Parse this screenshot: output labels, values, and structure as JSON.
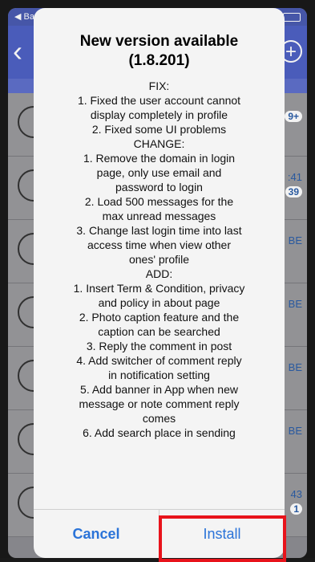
{
  "background_app": {
    "status_back": "◀ Ba",
    "rows": [
      {
        "meta_top": "",
        "badge": "9+"
      },
      {
        "meta_top": ":41",
        "badge": "39"
      },
      {
        "meta_top": "BE",
        "badge": ""
      },
      {
        "meta_top": "BE",
        "badge": ""
      },
      {
        "meta_top": "BE",
        "badge": ""
      },
      {
        "meta_top": "BE",
        "badge": ""
      },
      {
        "meta_top": "43",
        "badge": "1"
      }
    ]
  },
  "dialog": {
    "title_line1": "New version available",
    "title_line2": "(1.8.201)",
    "body_lines": [
      "FIX:",
      "1. Fixed the user account cannot",
      "display completely in profile",
      "2. Fixed some UI problems",
      "CHANGE:",
      "1. Remove the domain in login",
      "page, only use email and",
      "password to login",
      "2.  Load 500 messages for the",
      "max unread messages",
      "3.  Change last login time into last",
      "access time when view other",
      "ones' profile",
      "ADD:",
      "1. Insert Term & Condition, privacy",
      "and policy in about page",
      "2. Photo caption feature and the",
      "caption can be searched",
      "3. Reply the comment in post",
      "4. Add switcher of comment reply",
      "in notification setting",
      "5. Add banner in App when new",
      "message or note comment reply",
      "comes",
      "6. Add search place in sending"
    ],
    "cancel_label": "Cancel",
    "install_label": "Install"
  },
  "colors": {
    "app_bar": "#4f61c4",
    "dialog_button": "#2a73d8",
    "highlight_box": "#e8131b"
  }
}
